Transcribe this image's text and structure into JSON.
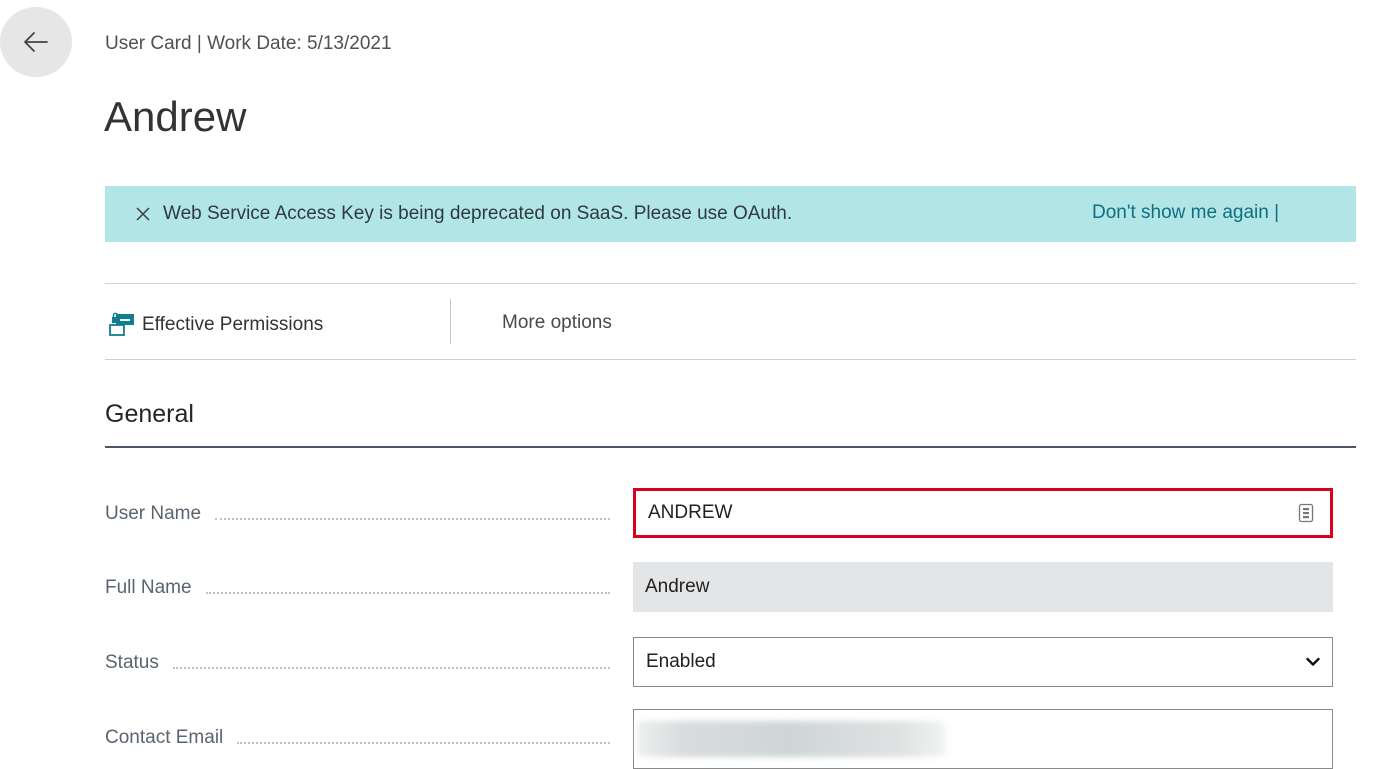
{
  "header": {
    "breadcrumb": "User Card | Work Date: 5/13/2021",
    "title": "Andrew"
  },
  "banner": {
    "message": "Web Service Access Key is being deprecated on SaaS. Please use OAuth.",
    "link": "Don't show me again |"
  },
  "actions": {
    "effective_permissions": "Effective Permissions",
    "more_options": "More options"
  },
  "section": {
    "title": "General"
  },
  "fields": {
    "user_name": {
      "label": "User Name",
      "value": "ANDREW"
    },
    "full_name": {
      "label": "Full Name",
      "value": "Andrew"
    },
    "status": {
      "label": "Status",
      "value": "Enabled"
    },
    "contact_email": {
      "label": "Contact Email"
    }
  },
  "colors": {
    "banner_bg": "#b2e6e6",
    "link": "#0f6f80",
    "highlight_border": "#d9001b"
  },
  "icons": [
    "back-arrow-icon",
    "close-icon",
    "permissions-icon",
    "assist-edit-icon",
    "chevron-down-icon"
  ]
}
